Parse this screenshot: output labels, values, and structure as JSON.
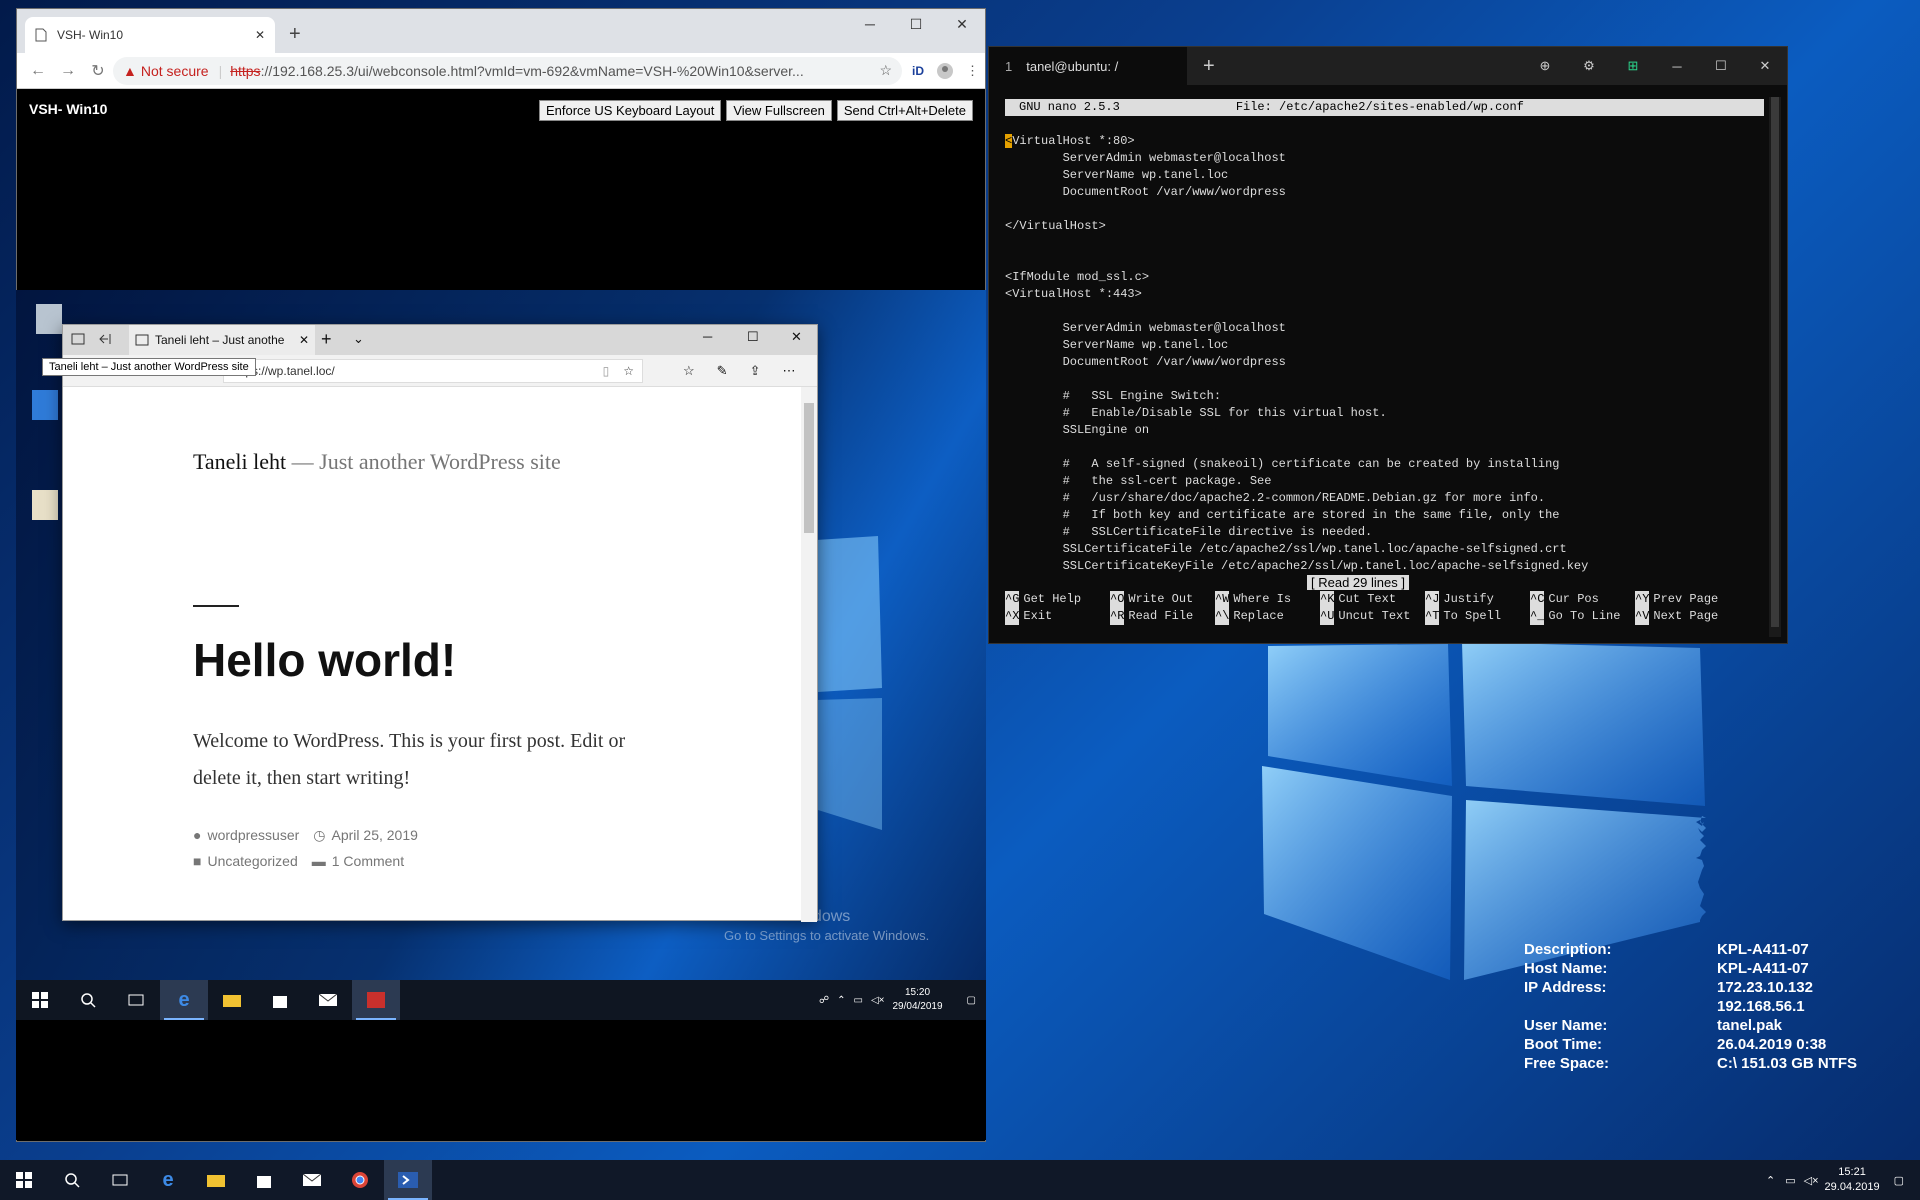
{
  "host": {
    "taskbar": {
      "clock_time": "15:21",
      "clock_date": "29.04.2019"
    },
    "bginfo": [
      {
        "key": "Description:",
        "value": "KPL-A411-07"
      },
      {
        "key": "Host Name:",
        "value": "KPL-A411-07"
      },
      {
        "key": "IP Address:",
        "value": "172.23.10.132"
      },
      {
        "key": "",
        "value": "192.168.56.1"
      },
      {
        "key": "User Name:",
        "value": "tanel.pak"
      },
      {
        "key": "Boot Time:",
        "value": "26.04.2019 0:38"
      },
      {
        "key": "Free Space:",
        "value": "C:\\ 151.03 GB NTFS"
      }
    ]
  },
  "chrome": {
    "tab_title": "VSH- Win10",
    "not_secure": "Not secure",
    "url_https": "https",
    "url_rest": "://192.168.25.3/ui/webconsole.html?vmId=vm-692&vmName=VSH-%20Win10&server...",
    "vm_title": "VSH- Win10",
    "buttons": {
      "enforce": "Enforce US Keyboard Layout",
      "fullscreen": "View Fullscreen",
      "cad": "Send Ctrl+Alt+Delete"
    }
  },
  "guest": {
    "watermark_title": "Activate Windows",
    "watermark_sub": "Go to Settings to activate Windows.",
    "clock_time": "15:20",
    "clock_date": "29/04/2019",
    "edge": {
      "tab_title": "Taneli leht – Just anothe",
      "tooltip": "Taneli leht – Just another WordPress site",
      "url": "https://wp.tanel.loc/",
      "site_name": "Taneli leht",
      "site_sep": "—",
      "tagline": "Just another WordPress site",
      "post_title": "Hello world!",
      "post_body": "Welcome to WordPress. This is your first post. Edit or delete it, then start writing!",
      "author": "wordpressuser",
      "date": "April 25, 2019",
      "category": "Uncategorized",
      "comments": "1 Comment"
    }
  },
  "terminal": {
    "tab_number": "1",
    "tab_title": "tanel@ubuntu: /",
    "nano_version": "GNU nano 2.5.3",
    "file_label": "File: /etc/apache2/sites-enabled/wp.conf",
    "lines": [
      "<VirtualHost *:80>",
      "        ServerAdmin webmaster@localhost",
      "        ServerName wp.tanel.loc",
      "        DocumentRoot /var/www/wordpress",
      "",
      "</VirtualHost>",
      "",
      "",
      "<IfModule mod_ssl.c>",
      "<VirtualHost *:443>",
      "",
      "        ServerAdmin webmaster@localhost",
      "        ServerName wp.tanel.loc",
      "        DocumentRoot /var/www/wordpress",
      "",
      "        #   SSL Engine Switch:",
      "        #   Enable/Disable SSL for this virtual host.",
      "        SSLEngine on",
      "",
      "        #   A self-signed (snakeoil) certificate can be created by installing",
      "        #   the ssl-cert package. See",
      "        #   /usr/share/doc/apache2.2-common/README.Debian.gz for more info.",
      "        #   If both key and certificate are stored in the same file, only the",
      "        #   SSLCertificateFile directive is needed.",
      "        SSLCertificateFile /etc/apache2/ssl/wp.tanel.loc/apache-selfsigned.crt",
      "        SSLCertificateKeyFile /etc/apache2/ssl/wp.tanel.loc/apache-selfsigned.key"
    ],
    "status": "[ Read 29 lines ]",
    "shortcuts_row1": [
      {
        "key": "^G",
        "label": "Get Help"
      },
      {
        "key": "^O",
        "label": "Write Out"
      },
      {
        "key": "^W",
        "label": "Where Is"
      },
      {
        "key": "^K",
        "label": "Cut Text"
      },
      {
        "key": "^J",
        "label": "Justify"
      },
      {
        "key": "^C",
        "label": "Cur Pos"
      },
      {
        "key": "^Y",
        "label": "Prev Page"
      }
    ],
    "shortcuts_row2": [
      {
        "key": "^X",
        "label": "Exit"
      },
      {
        "key": "^R",
        "label": "Read File"
      },
      {
        "key": "^\\",
        "label": "Replace"
      },
      {
        "key": "^U",
        "label": "Uncut Text"
      },
      {
        "key": "^T",
        "label": "To Spell"
      },
      {
        "key": "^_",
        "label": "Go To Line"
      },
      {
        "key": "^V",
        "label": "Next Page"
      }
    ]
  }
}
